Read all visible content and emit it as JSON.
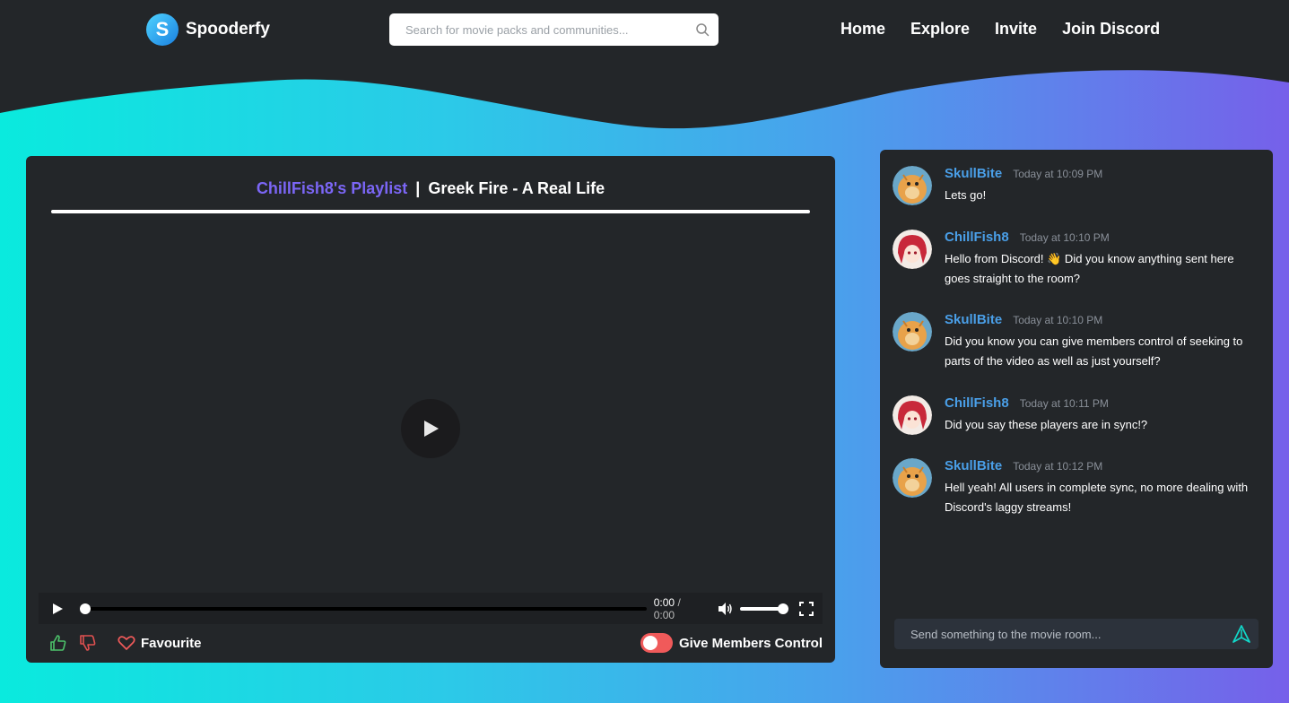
{
  "app": {
    "name": "Spooderfy"
  },
  "search": {
    "placeholder": "Search for movie packs and communities..."
  },
  "nav": {
    "items": [
      "Home",
      "Explore",
      "Invite",
      "Join Discord"
    ]
  },
  "player": {
    "playlist": "ChillFish8's Playlist",
    "separator": "|",
    "video_title": "Greek Fire - A Real Life",
    "current_time": "0:00",
    "time_sep": "/",
    "duration": "0:00",
    "seek_progress": 0,
    "volume_level": 1
  },
  "actions": {
    "favourite_label": "Favourite",
    "give_control_label": "Give Members Control",
    "give_control_enabled": false
  },
  "chat": {
    "messages": [
      {
        "user": "SkullBite",
        "time": "Today at 10:09 PM",
        "text": "Lets go!",
        "avatar": "dragonite-avatar"
      },
      {
        "user": "ChillFish8",
        "time": "Today at 10:10 PM",
        "text": "Hello from Discord! 👋 Did you know anything sent here goes straight to the room?",
        "avatar": "anime-girl-avatar"
      },
      {
        "user": "SkullBite",
        "time": "Today at 10:10 PM",
        "text": "Did you know you can give members control of seeking to parts of the video as well as just yourself?",
        "avatar": "dragonite-avatar"
      },
      {
        "user": "ChillFish8",
        "time": "Today at 10:11 PM",
        "text": "Did you say these players are in sync!?",
        "avatar": "anime-girl-avatar"
      },
      {
        "user": "SkullBite",
        "time": "Today at 10:12 PM",
        "text": "Hell yeah! All users in complete sync, no more dealing with Discord's laggy streams!",
        "avatar": "dragonite-avatar"
      }
    ],
    "input_placeholder": "Send something to the movie room..."
  },
  "colors": {
    "accent_purple": "#7b66f5",
    "username_blue": "#4a9fe8",
    "toggle_off": "#f05a5a",
    "card_bg": "#232629",
    "header_bg": "#232629"
  }
}
